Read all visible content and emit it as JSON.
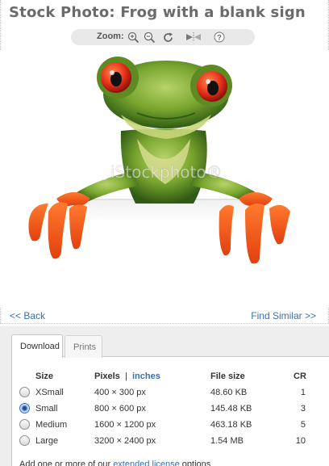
{
  "page": {
    "title": "Stock Photo: Frog with a blank sign"
  },
  "zoom": {
    "label": "Zoom:",
    "icons": [
      "zoom-in-icon",
      "zoom-out-icon",
      "rotate-icon",
      "flip-icon",
      "help-icon"
    ]
  },
  "photo": {
    "watermark": "iStockphoto®",
    "subject": "frog-with-blank-sign"
  },
  "nav": {
    "back": "<< Back",
    "similar": "Find Similar >>"
  },
  "tabs": [
    {
      "label": "Download",
      "active": true
    },
    {
      "label": "Prints",
      "active": false
    }
  ],
  "table": {
    "headers": {
      "size": "Size",
      "pixels": "Pixels",
      "separator": "|",
      "inches": "inches",
      "filesize": "File size",
      "cr": "CR"
    },
    "rows": [
      {
        "size": "XSmall",
        "pixels": "400 × 300 px",
        "filesize": "48.60 KB",
        "cr": "1",
        "selected": false
      },
      {
        "size": "Small",
        "pixels": "800 × 600 px",
        "filesize": "145.48 KB",
        "cr": "3",
        "selected": true
      },
      {
        "size": "Medium",
        "pixels": "1600 × 1200 px",
        "filesize": "463.18 KB",
        "cr": "5",
        "selected": false
      },
      {
        "size": "Large",
        "pixels": "3200 × 2400 px",
        "filesize": "1.54 MB",
        "cr": "10",
        "selected": false
      }
    ]
  },
  "footer": {
    "prefix": "Add one or more of our ",
    "link": "extended license",
    "suffix": " options"
  },
  "colors": {
    "link": "#3a6fb0",
    "panel": "#eeeeee",
    "frog_green": "#6fa02c",
    "frog_orange": "#f15a1d"
  }
}
